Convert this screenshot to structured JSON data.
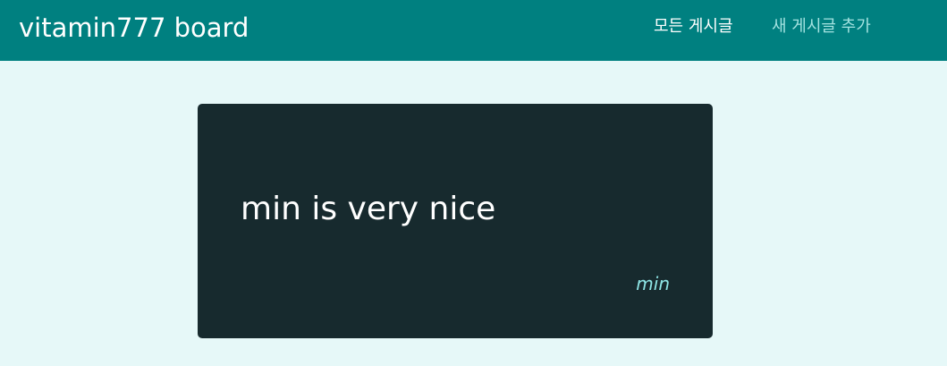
{
  "header": {
    "brand": "vitamin777 board",
    "nav": {
      "all_posts": "모든 게시글",
      "add_post": "새 게시글 추가"
    }
  },
  "post": {
    "content": "min is very nice",
    "author": "min"
  },
  "colors": {
    "header_bg": "#008080",
    "page_bg": "#e6f8f8",
    "card_bg": "#172a2e",
    "nav_active": "#ffffff",
    "nav_inactive": "#a3e2e0",
    "author": "#8ee6e6"
  }
}
